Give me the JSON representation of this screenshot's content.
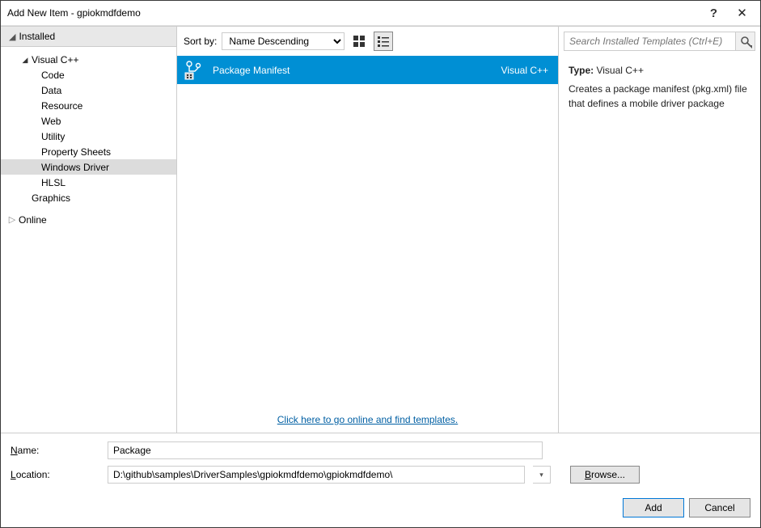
{
  "window": {
    "title": "Add New Item - gpiokmdfdemo",
    "help": "?",
    "close": "✕"
  },
  "left": {
    "installed_header": "Installed",
    "vcpp_group": "Visual C++",
    "items": [
      "Code",
      "Data",
      "Resource",
      "Web",
      "Utility",
      "Property Sheets",
      "Windows Driver",
      "HLSL"
    ],
    "graphics": "Graphics",
    "online": "Online"
  },
  "center": {
    "sort_label": "Sort by:",
    "sort_value": "Name Descending",
    "template": {
      "name": "Package Manifest",
      "lang": "Visual C++"
    },
    "online_link": "Click here to go online and find templates."
  },
  "right": {
    "search_placeholder": "Search Installed Templates (Ctrl+E)",
    "type_label": "Type:",
    "type_value": "Visual C++",
    "description": "Creates a package manifest (pkg.xml) file that defines a mobile driver package"
  },
  "bottom": {
    "name_label_pre": "N",
    "name_label_post": "ame:",
    "name_value": "Package",
    "location_label_pre": "L",
    "location_label_post": "ocation:",
    "location_value": "D:\\github\\samples\\DriverSamples\\gpiokmdfdemo\\gpiokmdfdemo\\",
    "browse_pre": "B",
    "browse_post": "rowse...",
    "add_pre": "A",
    "add_post": "dd",
    "cancel": "Cancel"
  }
}
